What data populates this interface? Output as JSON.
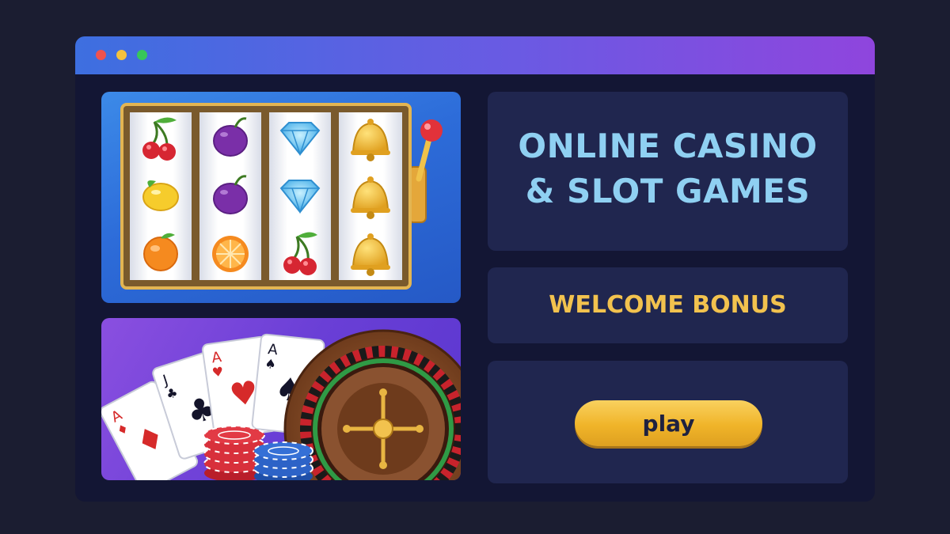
{
  "window": {
    "controls": [
      "close",
      "minimize",
      "maximize"
    ],
    "accent_gradient": [
      "#3d6fe0",
      "#8f45dd"
    ]
  },
  "slot_machine": {
    "reels": [
      [
        "cherries-icon",
        "lemon-icon",
        "orange-icon"
      ],
      [
        "plum-icon",
        "plum-icon",
        "orange-slice-icon"
      ],
      [
        "diamond-icon",
        "diamond-icon",
        "cherries-icon"
      ],
      [
        "bell-icon",
        "bell-icon",
        "bell-icon"
      ]
    ],
    "lever": "slot-lever-icon"
  },
  "table_games": {
    "cards": [
      {
        "rank": "A",
        "suit": "♦",
        "color": "#d62a2a"
      },
      {
        "rank": "J",
        "suit": "♣",
        "color": "#14142a"
      },
      {
        "rank": "A",
        "suit": "♥",
        "color": "#d62a2a"
      },
      {
        "rank": "A",
        "suit": "♠",
        "color": "#14142a"
      }
    ],
    "chips": [
      "red-chip-stack-icon",
      "blue-chip-stack-icon"
    ],
    "roulette": "roulette-wheel-icon"
  },
  "hero": {
    "title_line1": "ONLINE CASINO",
    "title_line2": "& SLOT GAMES"
  },
  "bonus": {
    "label": "WELCOME BONUS"
  },
  "cta": {
    "play_label": "play"
  },
  "colors": {
    "title": "#8fd0f2",
    "bonus": "#f2c24e",
    "button": "#f0b429",
    "card_bg": "#20264f"
  }
}
